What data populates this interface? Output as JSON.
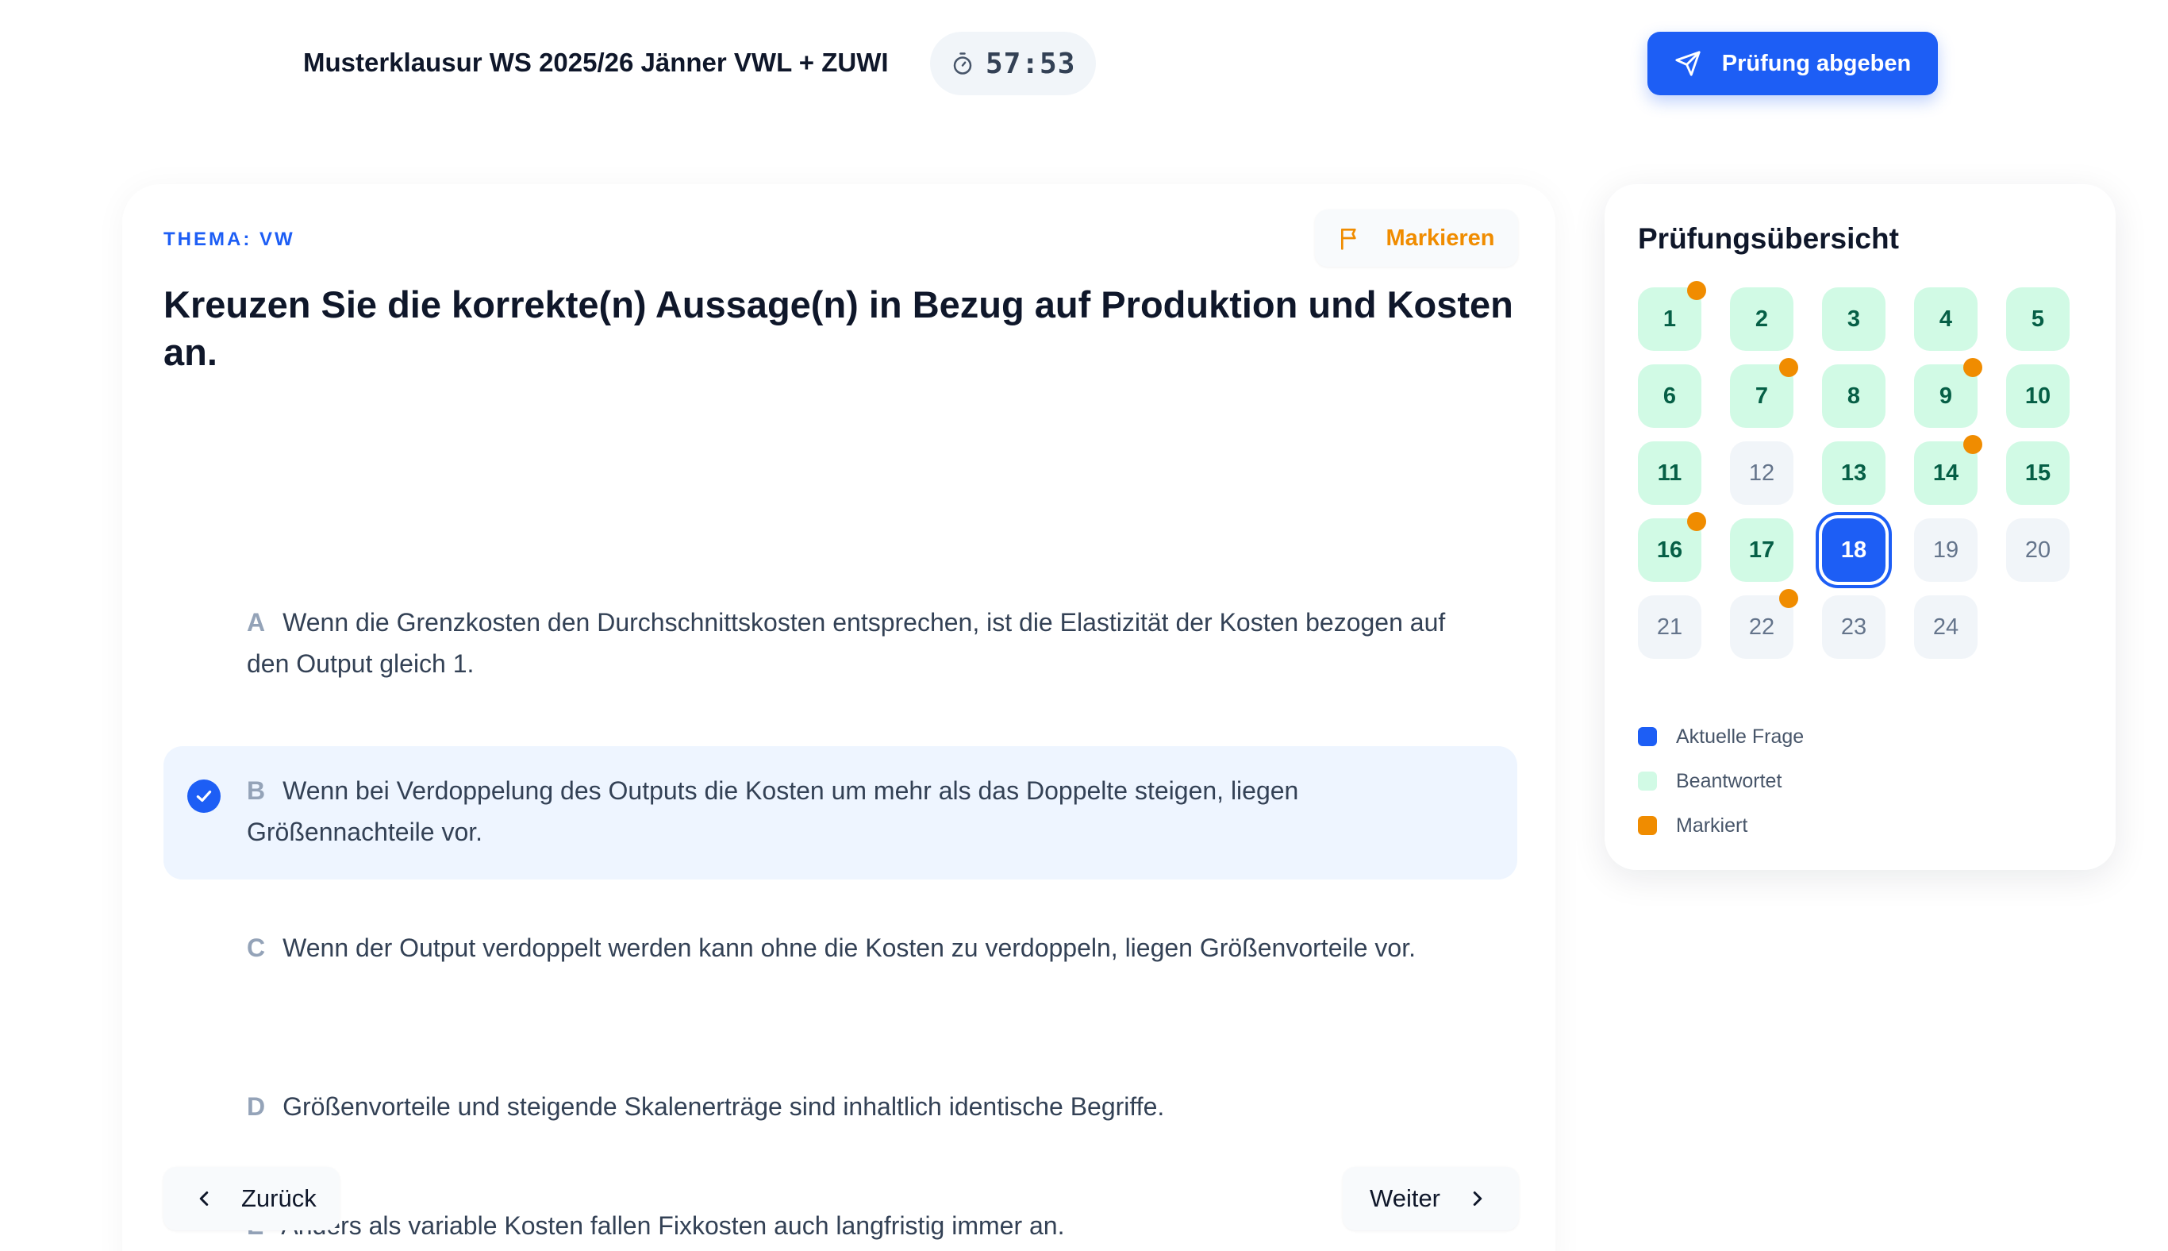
{
  "header": {
    "exam_title": "Musterklausur WS 2025/26 Jänner VWL + ZUWI",
    "timer": "57:53",
    "timer_icon": "stopwatch-icon",
    "submit_label": "Prüfung abgeben",
    "submit_icon": "send-icon"
  },
  "question": {
    "topic": "THEMA: VW",
    "mark_label": "Markieren",
    "mark_icon": "flag-icon",
    "text": "Kreuzen Sie die korrekte(n) Aussage(n) in Bezug auf Produktion und Kosten an.",
    "options": [
      {
        "letter": "A",
        "text": "Wenn die Grenzkosten den Durchschnittskosten entsprechen, ist die Elastizität der Kosten bezogen auf den Output gleich 1.",
        "selected": false
      },
      {
        "letter": "B",
        "text": "Wenn bei Verdoppelung des Outputs die Kosten um mehr als das Doppelte steigen, liegen Größennachteile vor.",
        "selected": true
      },
      {
        "letter": "C",
        "text": "Wenn der Output verdoppelt werden kann ohne die Kosten zu verdoppeln, liegen Größenvorteile vor.",
        "selected": false
      },
      {
        "letter": "D",
        "text": "Größenvorteile und steigende Skalenerträge sind inhaltlich identische Begriffe.",
        "selected": false
      },
      {
        "letter": "E",
        "text": "Anders als variable Kosten fallen Fixkosten auch langfristig immer an.",
        "selected": false
      }
    ],
    "back_label": "Zurück",
    "next_label": "Weiter"
  },
  "overview": {
    "title": "Prüfungsübersicht",
    "current": 18,
    "questions": [
      {
        "n": "1",
        "state": "answered",
        "marked": true
      },
      {
        "n": "2",
        "state": "answered",
        "marked": false
      },
      {
        "n": "3",
        "state": "answered",
        "marked": false
      },
      {
        "n": "4",
        "state": "answered",
        "marked": false
      },
      {
        "n": "5",
        "state": "answered",
        "marked": false
      },
      {
        "n": "6",
        "state": "answered",
        "marked": false
      },
      {
        "n": "7",
        "state": "answered",
        "marked": true
      },
      {
        "n": "8",
        "state": "answered",
        "marked": false
      },
      {
        "n": "9",
        "state": "answered",
        "marked": true
      },
      {
        "n": "10",
        "state": "answered",
        "marked": false
      },
      {
        "n": "11",
        "state": "answered",
        "marked": false
      },
      {
        "n": "12",
        "state": "unanswered",
        "marked": false
      },
      {
        "n": "13",
        "state": "answered",
        "marked": false
      },
      {
        "n": "14",
        "state": "answered",
        "marked": true
      },
      {
        "n": "15",
        "state": "answered",
        "marked": false
      },
      {
        "n": "16",
        "state": "answered",
        "marked": true
      },
      {
        "n": "17",
        "state": "answered",
        "marked": false
      },
      {
        "n": "18",
        "state": "current",
        "marked": false
      },
      {
        "n": "19",
        "state": "unanswered",
        "marked": false
      },
      {
        "n": "20",
        "state": "unanswered",
        "marked": false
      },
      {
        "n": "21",
        "state": "unanswered",
        "marked": false
      },
      {
        "n": "22",
        "state": "unanswered",
        "marked": true
      },
      {
        "n": "23",
        "state": "unanswered",
        "marked": false
      },
      {
        "n": "24",
        "state": "unanswered",
        "marked": false
      }
    ],
    "legend": [
      {
        "label": "Aktuelle Frage",
        "color": "#1d5ef5"
      },
      {
        "label": "Beantwortet",
        "color": "#d1fae5"
      },
      {
        "label": "Markiert",
        "color": "#f08c00"
      }
    ]
  },
  "colors": {
    "primary": "#1d5ef5",
    "marked": "#f08c00",
    "answered_bg": "#d1fae5",
    "selected_option_bg": "#eef5ff"
  }
}
